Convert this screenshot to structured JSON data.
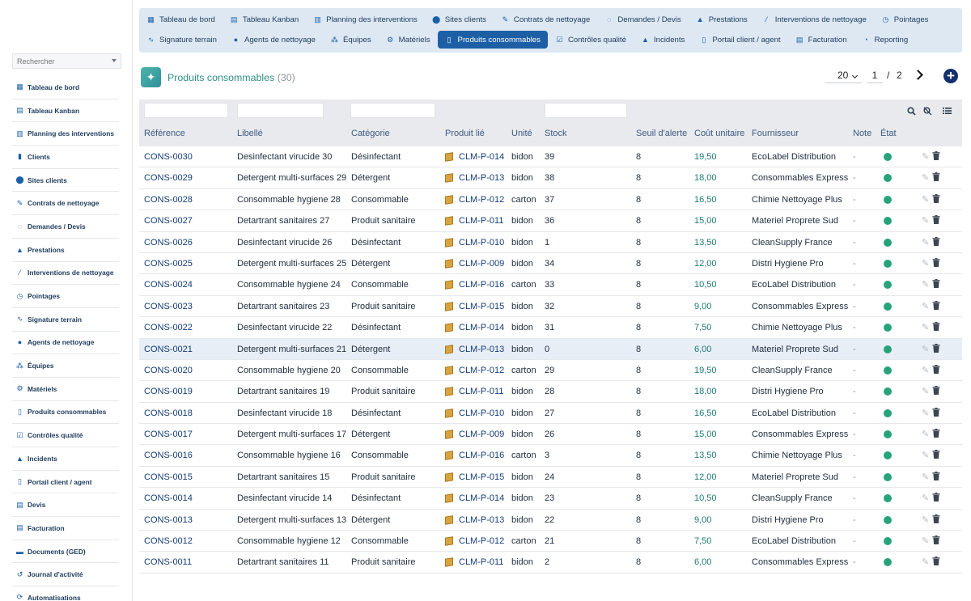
{
  "sidebar": {
    "search_placeholder": "Rechercher",
    "items": [
      {
        "label": "Tableau de bord",
        "icon": "dashboard-icon"
      },
      {
        "label": "Tableau Kanban",
        "icon": "kanban-icon"
      },
      {
        "label": "Planning des interventions",
        "icon": "calendar-icon"
      },
      {
        "label": "Clients",
        "icon": "building-icon"
      },
      {
        "label": "Sites clients",
        "icon": "map-pin-icon"
      },
      {
        "label": "Contrats de nettoyage",
        "icon": "contract-icon"
      },
      {
        "label": "Demandes / Devis",
        "icon": "headset-icon"
      },
      {
        "label": "Prestations",
        "icon": "service-icon"
      },
      {
        "label": "Interventions de nettoyage",
        "icon": "broom-icon"
      },
      {
        "label": "Pointages",
        "icon": "clock-icon"
      },
      {
        "label": "Signature terrain",
        "icon": "signature-icon"
      },
      {
        "label": "Agents de nettoyage",
        "icon": "user-icon"
      },
      {
        "label": "Équipes",
        "icon": "users-icon"
      },
      {
        "label": "Matériels",
        "icon": "cogs-icon"
      },
      {
        "label": "Produits consommables",
        "icon": "bottle-icon"
      },
      {
        "label": "Contrôles qualité",
        "icon": "clipboard-check-icon"
      },
      {
        "label": "Incidents",
        "icon": "warning-icon"
      },
      {
        "label": "Portail client / agent",
        "icon": "mobile-icon"
      },
      {
        "label": "Devis",
        "icon": "document-icon"
      },
      {
        "label": "Facturation",
        "icon": "invoice-icon"
      },
      {
        "label": "Documents (GED)",
        "icon": "folder-icon"
      },
      {
        "label": "Journal d'activité",
        "icon": "history-icon"
      },
      {
        "label": "Automatisations",
        "icon": "automation-icon"
      }
    ]
  },
  "topnav": {
    "row1": [
      {
        "label": "Tableau de bord",
        "icon": "dashboard-icon"
      },
      {
        "label": "Tableau Kanban",
        "icon": "kanban-icon"
      },
      {
        "label": "Planning des interventions",
        "icon": "calendar-icon"
      },
      {
        "label": "Sites clients",
        "icon": "map-pin-icon"
      },
      {
        "label": "Contrats de nettoyage",
        "icon": "contract-icon"
      },
      {
        "label": "Demandes / Devis",
        "icon": "headset-icon"
      },
      {
        "label": "Prestations",
        "icon": "service-icon"
      },
      {
        "label": "Interventions de nettoyage",
        "icon": "broom-icon"
      },
      {
        "label": "Pointages",
        "icon": "clock-icon"
      }
    ],
    "row2": [
      {
        "label": "Signature terrain",
        "icon": "signature-icon"
      },
      {
        "label": "Agents de nettoyage",
        "icon": "user-icon"
      },
      {
        "label": "Équipes",
        "icon": "users-icon"
      },
      {
        "label": "Matériels",
        "icon": "cogs-icon"
      },
      {
        "label": "Produits consommables",
        "icon": "bottle-icon",
        "active": true
      },
      {
        "label": "Contrôles qualité",
        "icon": "clipboard-check-icon"
      },
      {
        "label": "Incidents",
        "icon": "warning-icon"
      },
      {
        "label": "Portail client / agent",
        "icon": "mobile-icon"
      },
      {
        "label": "Facturation",
        "icon": "invoice-icon"
      },
      {
        "label": "Reporting",
        "icon": "chart-pie-icon"
      }
    ]
  },
  "page": {
    "title": "Produits consommables",
    "count": "(30)"
  },
  "pager": {
    "page_size": "20",
    "current_page": "1",
    "separator": "/",
    "total_pages": "2"
  },
  "table": {
    "columns": {
      "ref": "Référence",
      "libelle": "Libellé",
      "categorie": "Catégorie",
      "produit": "Produit lié",
      "unite": "Unité",
      "stock": "Stock",
      "seuil": "Seuil d'alerte",
      "cout": "Coût unitaire",
      "fournisseur": "Fournisseur",
      "note": "Note",
      "etat": "État"
    },
    "status_color": "#27a37a",
    "rows": [
      {
        "ref": "CONS-0030",
        "libelle": "Desinfectant virucide 30",
        "categorie": "Désinfectant",
        "produit": "CLM-P-014",
        "unite": "bidon",
        "stock": "39",
        "seuil": "8",
        "cout": "19,50",
        "fournisseur": "EcoLabel Distribution",
        "note": "-"
      },
      {
        "ref": "CONS-0029",
        "libelle": "Detergent multi-surfaces 29",
        "categorie": "Détergent",
        "produit": "CLM-P-013",
        "unite": "bidon",
        "stock": "38",
        "seuil": "8",
        "cout": "18,00",
        "fournisseur": "Consommables Express",
        "note": "-"
      },
      {
        "ref": "CONS-0028",
        "libelle": "Consommable hygiene 28",
        "categorie": "Consommable",
        "produit": "CLM-P-012",
        "unite": "carton",
        "stock": "37",
        "seuil": "8",
        "cout": "16,50",
        "fournisseur": "Chimie Nettoyage Plus",
        "note": "-"
      },
      {
        "ref": "CONS-0027",
        "libelle": "Detartrant sanitaires 27",
        "categorie": "Produit sanitaire",
        "produit": "CLM-P-011",
        "unite": "bidon",
        "stock": "36",
        "seuil": "8",
        "cout": "15,00",
        "fournisseur": "Materiel Proprete Sud",
        "note": "-"
      },
      {
        "ref": "CONS-0026",
        "libelle": "Desinfectant virucide 26",
        "categorie": "Désinfectant",
        "produit": "CLM-P-010",
        "unite": "bidon",
        "stock": "1",
        "seuil": "8",
        "cout": "13,50",
        "fournisseur": "CleanSupply France",
        "note": "-"
      },
      {
        "ref": "CONS-0025",
        "libelle": "Detergent multi-surfaces 25",
        "categorie": "Détergent",
        "produit": "CLM-P-009",
        "unite": "bidon",
        "stock": "34",
        "seuil": "8",
        "cout": "12,00",
        "fournisseur": "Distri Hygiene Pro",
        "note": "-"
      },
      {
        "ref": "CONS-0024",
        "libelle": "Consommable hygiene 24",
        "categorie": "Consommable",
        "produit": "CLM-P-016",
        "unite": "carton",
        "stock": "33",
        "seuil": "8",
        "cout": "10,50",
        "fournisseur": "EcoLabel Distribution",
        "note": "-"
      },
      {
        "ref": "CONS-0023",
        "libelle": "Detartrant sanitaires 23",
        "categorie": "Produit sanitaire",
        "produit": "CLM-P-015",
        "unite": "bidon",
        "stock": "32",
        "seuil": "8",
        "cout": "9,00",
        "fournisseur": "Consommables Express",
        "note": "-"
      },
      {
        "ref": "CONS-0022",
        "libelle": "Desinfectant virucide 22",
        "categorie": "Désinfectant",
        "produit": "CLM-P-014",
        "unite": "bidon",
        "stock": "31",
        "seuil": "8",
        "cout": "7,50",
        "fournisseur": "Chimie Nettoyage Plus",
        "note": "-"
      },
      {
        "ref": "CONS-0021",
        "libelle": "Detergent multi-surfaces 21",
        "categorie": "Détergent",
        "produit": "CLM-P-013",
        "unite": "bidon",
        "stock": "0",
        "seuil": "8",
        "cout": "6,00",
        "fournisseur": "Materiel Proprete Sud",
        "note": "-",
        "highlight": true
      },
      {
        "ref": "CONS-0020",
        "libelle": "Consommable hygiene 20",
        "categorie": "Consommable",
        "produit": "CLM-P-012",
        "unite": "carton",
        "stock": "29",
        "seuil": "8",
        "cout": "19,50",
        "fournisseur": "CleanSupply France",
        "note": "-"
      },
      {
        "ref": "CONS-0019",
        "libelle": "Detartrant sanitaires 19",
        "categorie": "Produit sanitaire",
        "produit": "CLM-P-011",
        "unite": "bidon",
        "stock": "28",
        "seuil": "8",
        "cout": "18,00",
        "fournisseur": "Distri Hygiene Pro",
        "note": "-"
      },
      {
        "ref": "CONS-0018",
        "libelle": "Desinfectant virucide 18",
        "categorie": "Désinfectant",
        "produit": "CLM-P-010",
        "unite": "bidon",
        "stock": "27",
        "seuil": "8",
        "cout": "16,50",
        "fournisseur": "EcoLabel Distribution",
        "note": "-"
      },
      {
        "ref": "CONS-0017",
        "libelle": "Detergent multi-surfaces 17",
        "categorie": "Détergent",
        "produit": "CLM-P-009",
        "unite": "bidon",
        "stock": "26",
        "seuil": "8",
        "cout": "15,00",
        "fournisseur": "Consommables Express",
        "note": "-"
      },
      {
        "ref": "CONS-0016",
        "libelle": "Consommable hygiene 16",
        "categorie": "Consommable",
        "produit": "CLM-P-016",
        "unite": "carton",
        "stock": "3",
        "seuil": "8",
        "cout": "13,50",
        "fournisseur": "Chimie Nettoyage Plus",
        "note": "-"
      },
      {
        "ref": "CONS-0015",
        "libelle": "Detartrant sanitaires 15",
        "categorie": "Produit sanitaire",
        "produit": "CLM-P-015",
        "unite": "bidon",
        "stock": "24",
        "seuil": "8",
        "cout": "12,00",
        "fournisseur": "Materiel Proprete Sud",
        "note": "-"
      },
      {
        "ref": "CONS-0014",
        "libelle": "Desinfectant virucide 14",
        "categorie": "Désinfectant",
        "produit": "CLM-P-014",
        "unite": "bidon",
        "stock": "23",
        "seuil": "8",
        "cout": "10,50",
        "fournisseur": "CleanSupply France",
        "note": "-"
      },
      {
        "ref": "CONS-0013",
        "libelle": "Detergent multi-surfaces 13",
        "categorie": "Détergent",
        "produit": "CLM-P-013",
        "unite": "bidon",
        "stock": "22",
        "seuil": "8",
        "cout": "9,00",
        "fournisseur": "Distri Hygiene Pro",
        "note": "-"
      },
      {
        "ref": "CONS-0012",
        "libelle": "Consommable hygiene 12",
        "categorie": "Consommable",
        "produit": "CLM-P-012",
        "unite": "carton",
        "stock": "21",
        "seuil": "8",
        "cout": "7,50",
        "fournisseur": "EcoLabel Distribution",
        "note": "-"
      },
      {
        "ref": "CONS-0011",
        "libelle": "Detartrant sanitaires 11",
        "categorie": "Produit sanitaire",
        "produit": "CLM-P-011",
        "unite": "bidon",
        "stock": "2",
        "seuil": "8",
        "cout": "6,00",
        "fournisseur": "Consommables Express",
        "note": "-"
      }
    ]
  },
  "toolbar": {
    "search_icon": "search-icon",
    "clear_filter_icon": "filter-clear-icon",
    "columns_icon": "list-columns-icon"
  }
}
